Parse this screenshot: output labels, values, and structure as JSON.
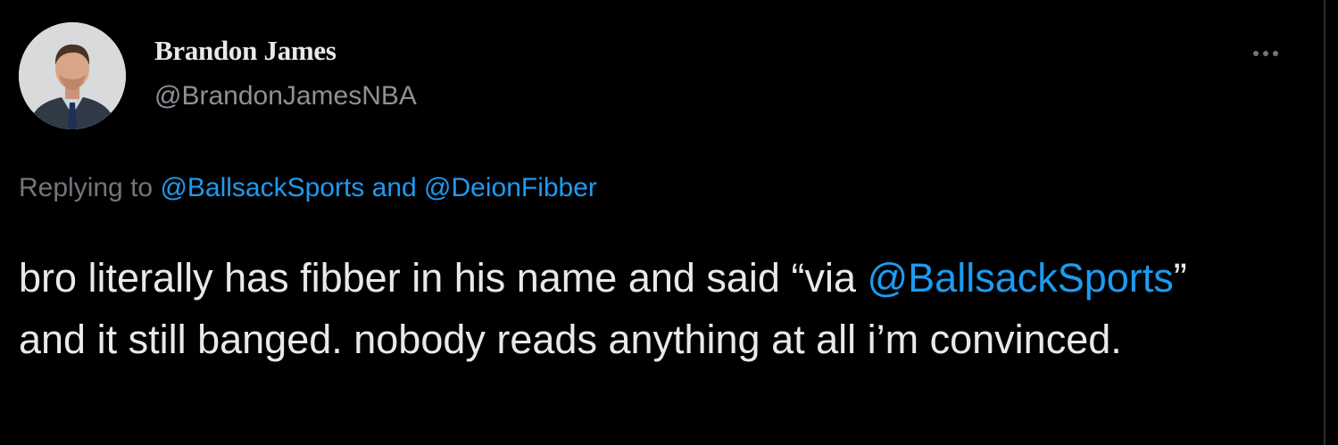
{
  "tweet": {
    "author": {
      "display_name": "Brandon James",
      "handle": "@BrandonJamesNBA",
      "avatar_icon": "profile-photo"
    },
    "more_icon": "more-options-icon",
    "reply": {
      "prefix": "Replying to ",
      "mentions": [
        "@BallsackSports",
        "@DeionFibber"
      ],
      "joiner": " and "
    },
    "text": {
      "part1": "bro literally has fibber in his name and said “via ",
      "mention": "@BallsackSports",
      "part2": "” and it still banged. nobody reads anything at all i’m convinced."
    }
  },
  "colors": {
    "background": "#000000",
    "text_primary": "#e7e9ea",
    "text_secondary": "#71767b",
    "link": "#1d9bf0"
  }
}
